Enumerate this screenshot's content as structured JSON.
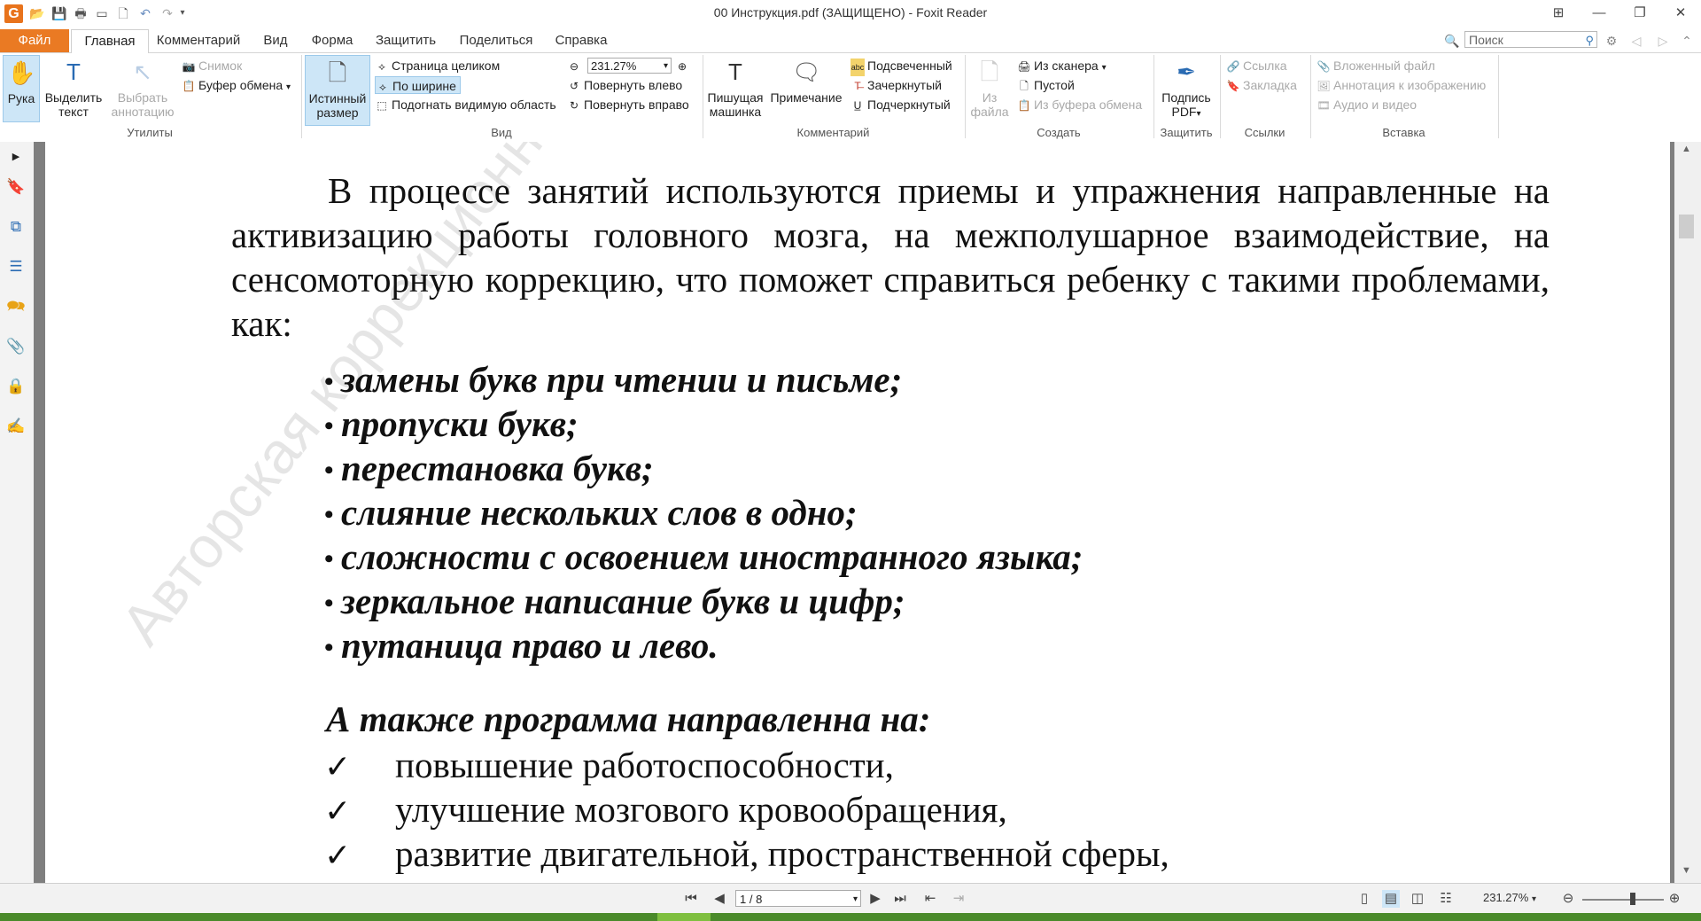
{
  "window": {
    "title": "00 Инструкция.pdf (ЗАЩИЩЕНО) - Foxit Reader"
  },
  "menu": {
    "file": "Файл",
    "tabs": [
      "Главная",
      "Комментарий",
      "Вид",
      "Форма",
      "Защитить",
      "Поделиться",
      "Справка"
    ],
    "search_placeholder": "Поиск"
  },
  "ribbon": {
    "utilities": {
      "label": "Утилиты",
      "hand": "Рука",
      "select_text_1": "Выделить",
      "select_text_2": "текст",
      "select_annot_1": "Выбрать",
      "select_annot_2": "аннотацию",
      "snapshot": "Снимок",
      "clipboard": "Буфер обмена"
    },
    "view": {
      "label": "Вид",
      "actual_size_1": "Истинный",
      "actual_size_2": "размер",
      "fit_page": "Страница целиком",
      "fit_width": "По ширине",
      "fit_visible": "Подогнать видимую область",
      "zoom_value": "231.27%",
      "rotate_left": "Повернуть влево",
      "rotate_right": "Повернуть вправо"
    },
    "comment": {
      "label": "Комментарий",
      "typewriter_1": "Пишущая",
      "typewriter_2": "машинка",
      "note": "Примечание",
      "highlight": "Подсвеченный",
      "strikeout": "Зачеркнутый",
      "underline": "Подчеркнутый"
    },
    "create": {
      "label": "Создать",
      "from_file_1": "Из",
      "from_file_2": "файла",
      "from_scanner": "Из сканера",
      "blank": "Пустой",
      "from_clipboard": "Из буфера обмена"
    },
    "protect": {
      "label": "Защитить",
      "sign_1": "Подпись",
      "sign_2": "PDF"
    },
    "links": {
      "label": "Ссылки",
      "link": "Ссылка",
      "bookmark": "Закладка"
    },
    "insert": {
      "label": "Вставка",
      "attachment": "Вложенный файл",
      "image_annot": "Аннотация к изображению",
      "audio_video": "Аудио и видео"
    }
  },
  "document": {
    "watermark": "Авторская коррекционно-развивающая",
    "paragraph": "В процессе занятий используются приемы и упражнения направленные на активизацию работы головного мозга, на межполушарное взаимодействие, на сенсомоторную коррекцию, что поможет справиться ребенку с такими проблемами, как:",
    "bullets": [
      "замены букв при чтении и письме;",
      "пропуски букв;",
      "перестановка букв;",
      "слияние нескольких слов в одно;",
      "сложности с освоением иностранного языка;",
      "зеркальное написание букв и цифр;",
      "путаница право и лево."
    ],
    "bullet_symbol": "•",
    "heading": "А также программа направленна на:",
    "check_symbol": "✓",
    "checks": [
      "повышение работоспособности,",
      "улучшение мозгового кровообращения,",
      "развитие двигательной, пространственной сферы,"
    ]
  },
  "status": {
    "page": "1 / 8",
    "zoom": "231.27%"
  }
}
